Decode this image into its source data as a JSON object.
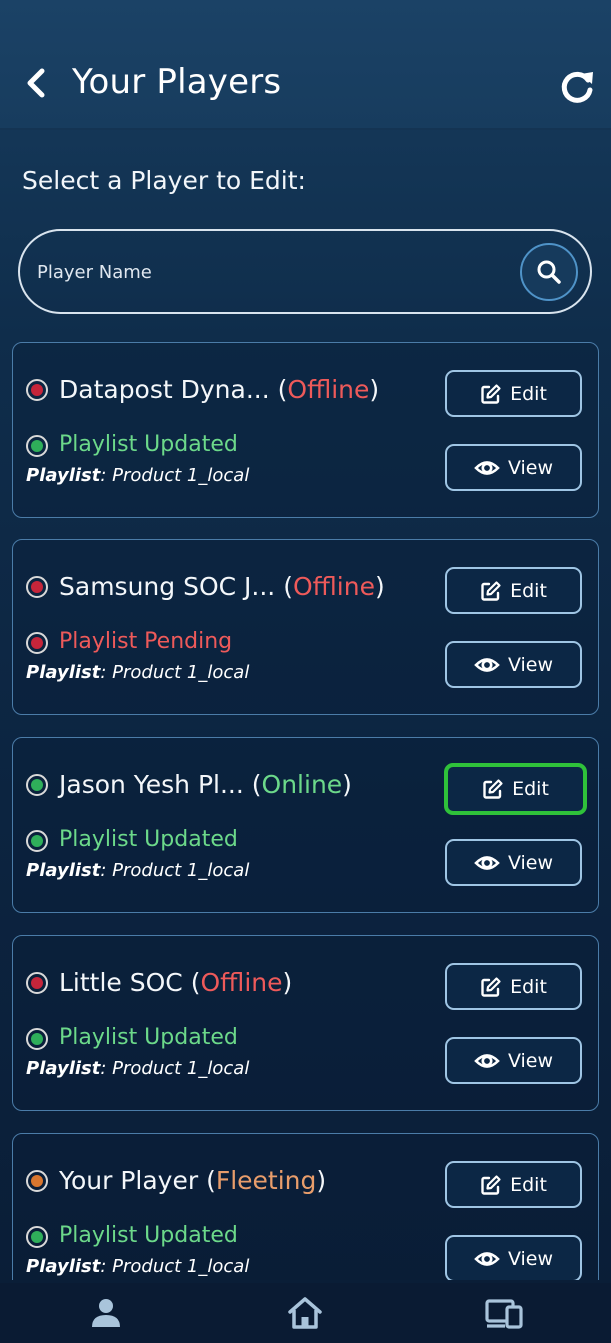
{
  "header": {
    "title": "Your Players",
    "back_icon": "chevron-left-icon",
    "refresh_icon": "refresh-icon"
  },
  "section_label": "Select a Player to Edit:",
  "search": {
    "placeholder": "Player Name",
    "value": "",
    "icon": "search-icon"
  },
  "players": [
    {
      "name": "Datapost Dyna...",
      "status": "Offline",
      "status_color": "#ee5a5a",
      "dot": "red",
      "playlist_status": "Playlist Updated",
      "playlist_dot": "green",
      "playlist_label": "Playlist",
      "playlist_name": ": Product 1_local",
      "edit_label": "Edit",
      "view_label": "View"
    },
    {
      "name": "Samsung SOC J...",
      "status": "Offline",
      "status_color": "#ee5a5a",
      "dot": "red",
      "playlist_status": "Playlist Pending",
      "playlist_dot": "red",
      "playlist_label": "Playlist",
      "playlist_name": ": Product 1_local",
      "edit_label": "Edit",
      "view_label": "View"
    },
    {
      "name": "Jason Yesh Pl...",
      "status": "Online",
      "status_color": "#6cd98a",
      "dot": "green",
      "playlist_status": "Playlist Updated",
      "playlist_dot": "green",
      "playlist_label": "Playlist",
      "playlist_name": ": Product 1_local",
      "edit_label": "Edit",
      "view_label": "View",
      "edit_highlighted": true
    },
    {
      "name": "Little SOC",
      "status": "Offline",
      "status_color": "#ee5a5a",
      "dot": "red",
      "playlist_status": "Playlist Updated",
      "playlist_dot": "green",
      "playlist_label": "Playlist",
      "playlist_name": ": Product 1_local",
      "edit_label": "Edit",
      "view_label": "View"
    },
    {
      "name": "Your Player",
      "status": "Fleeting",
      "status_color": "#e89d6b",
      "dot": "orange",
      "playlist_status": "Playlist Updated",
      "playlist_dot": "green",
      "playlist_label": "Playlist",
      "playlist_name": ": Product 1_local",
      "edit_label": "Edit",
      "view_label": "View"
    }
  ],
  "bottom_nav": {
    "items": [
      "profile-icon",
      "home-icon",
      "devices-icon"
    ]
  },
  "colors": {
    "highlight": "#2fc23a",
    "online": "#6cd98a",
    "offline": "#ee5a5a",
    "fleeting": "#e89d6b"
  }
}
